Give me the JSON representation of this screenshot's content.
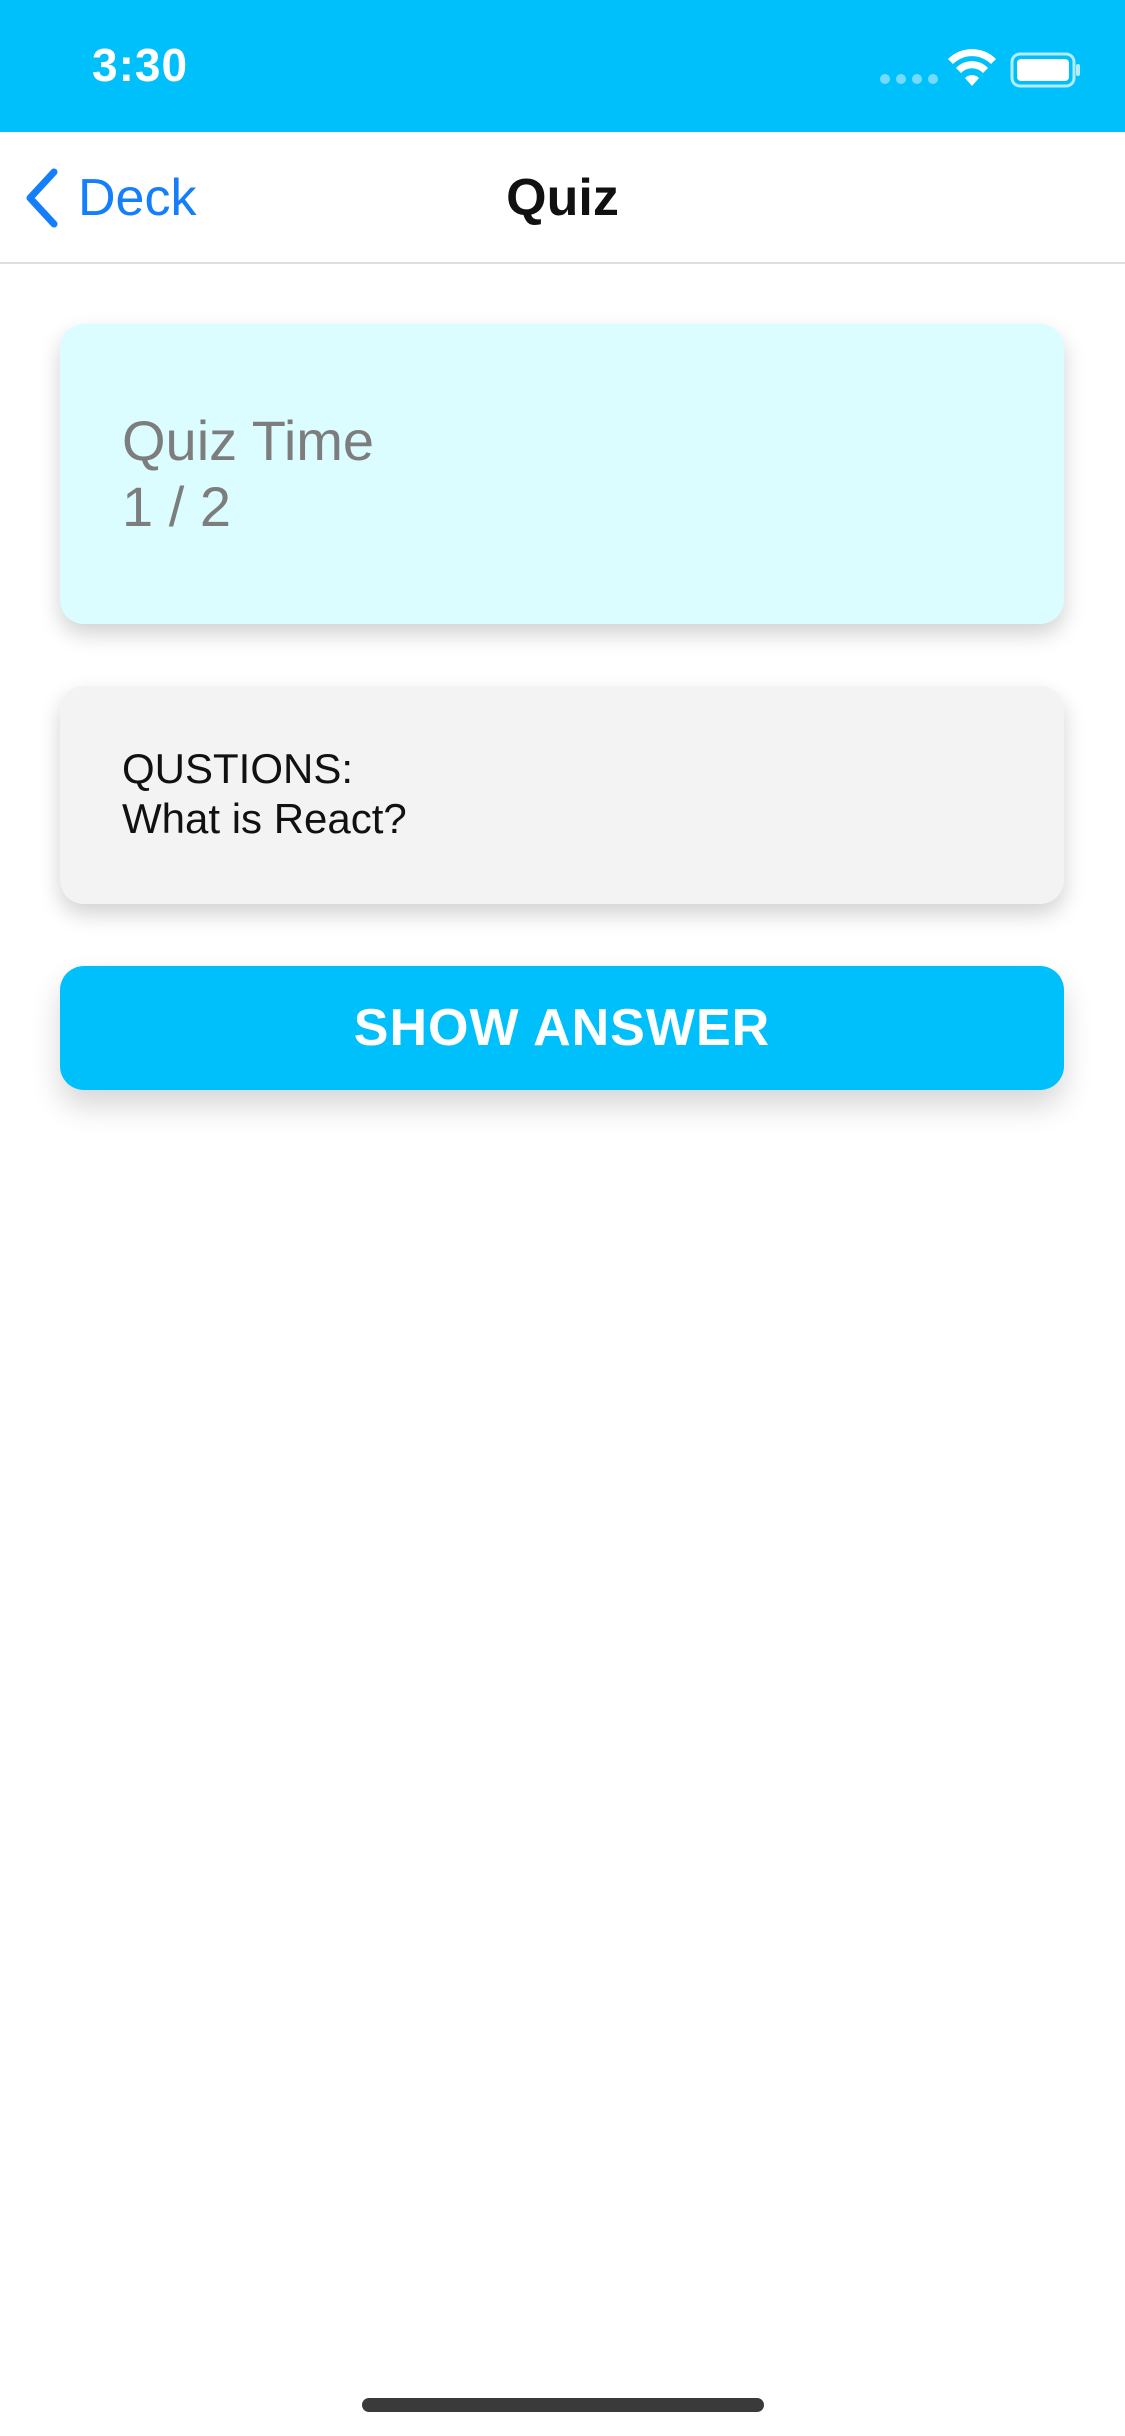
{
  "status_bar": {
    "time": "3:30",
    "background_color": "#00c0fc",
    "icons": [
      "signal-icon",
      "wifi-icon",
      "battery-icon"
    ]
  },
  "nav": {
    "back_label": "Deck",
    "title": "Quiz",
    "accent_color": "#147efb"
  },
  "info_card": {
    "title": "Quiz Time",
    "progress": "1 / 2",
    "background_color": "#dcfdff"
  },
  "question_card": {
    "heading": "QUSTIONS:",
    "question": "What is React?"
  },
  "actions": {
    "show_answer_label": "SHOW ANSWER",
    "button_color": "#00c0fc"
  }
}
